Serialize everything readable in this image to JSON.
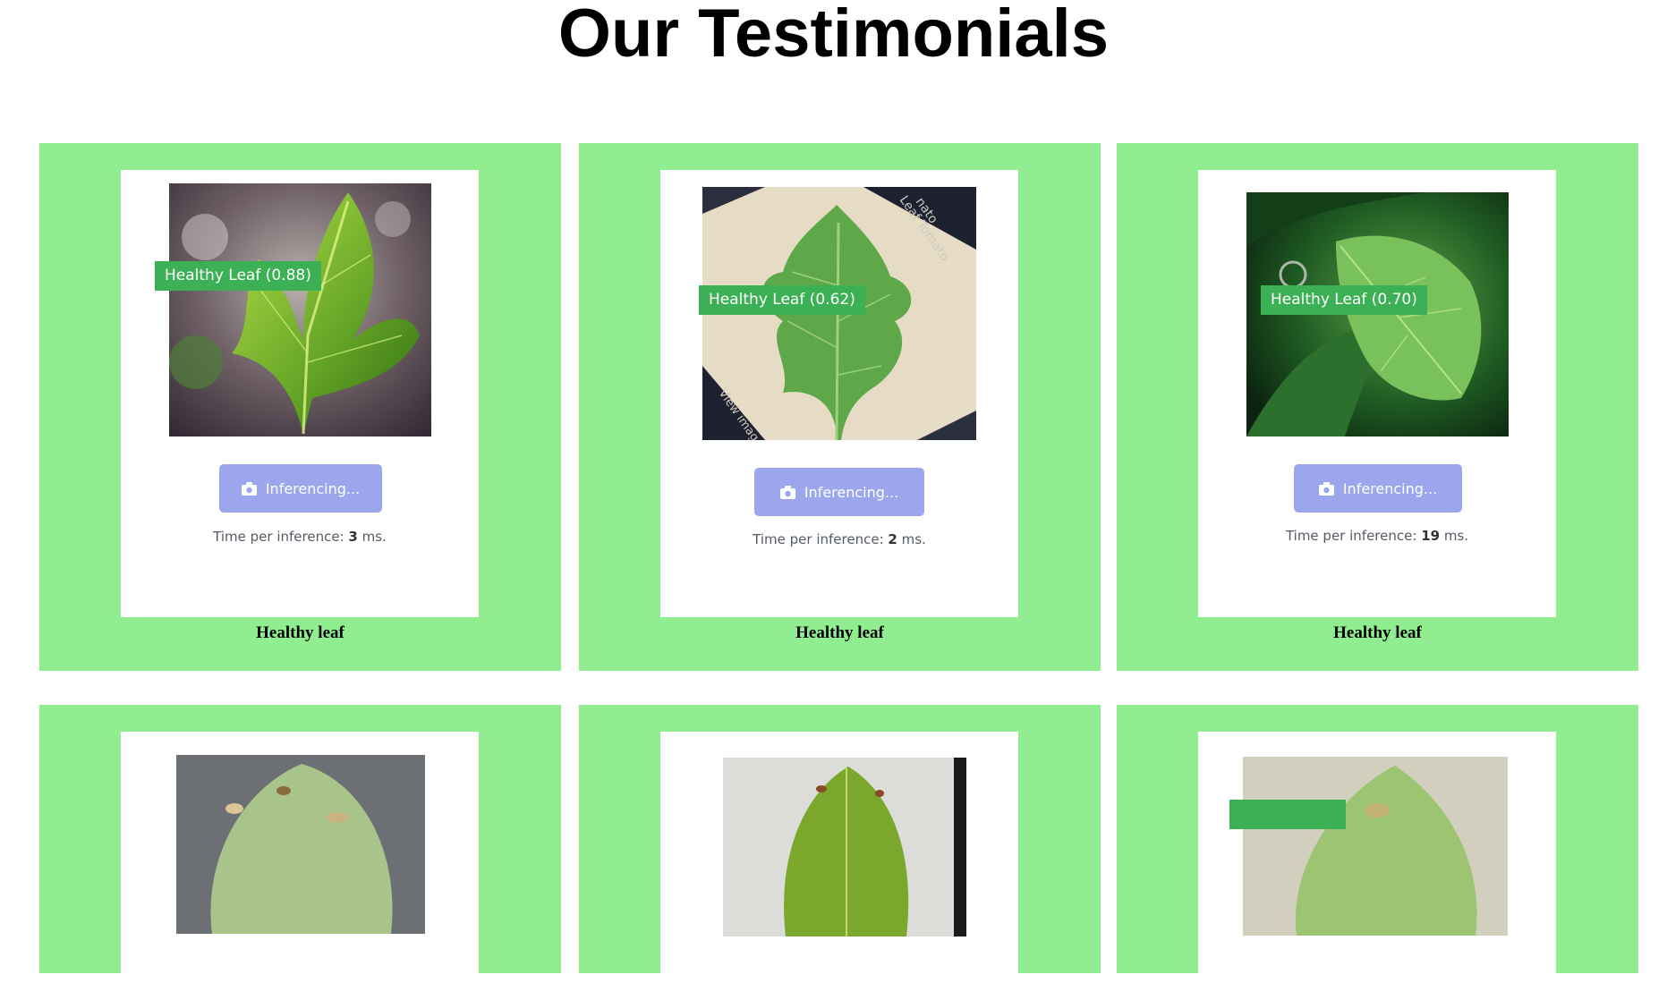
{
  "page": {
    "title": "Our Testimonials"
  },
  "colors": {
    "card_bg": "#90ee90",
    "label_bg": "#3cb054",
    "button_bg": "#9ba6ec"
  },
  "testimonials": [
    {
      "label": "Healthy Leaf (0.88)",
      "button": "Inferencing...",
      "timing_prefix": "Time per inference:",
      "ms": "3",
      "timing_suffix": "ms.",
      "caption": "Healthy leaf",
      "icon": "camera-icon"
    },
    {
      "label": "Healthy Leaf (0.62)",
      "button": "Inferencing...",
      "timing_prefix": "Time per inference:",
      "ms": "2",
      "timing_suffix": "ms.",
      "caption": "Healthy leaf",
      "photo_text": [
        "nato",
        "Leaf Tomato",
        "View imag"
      ],
      "icon": "camera-icon"
    },
    {
      "label": "Healthy Leaf (0.70)",
      "button": "Inferencing...",
      "timing_prefix": "Time per inference:",
      "ms": "19",
      "timing_suffix": "ms.",
      "caption": "Healthy leaf",
      "icon": "camera-icon"
    }
  ]
}
